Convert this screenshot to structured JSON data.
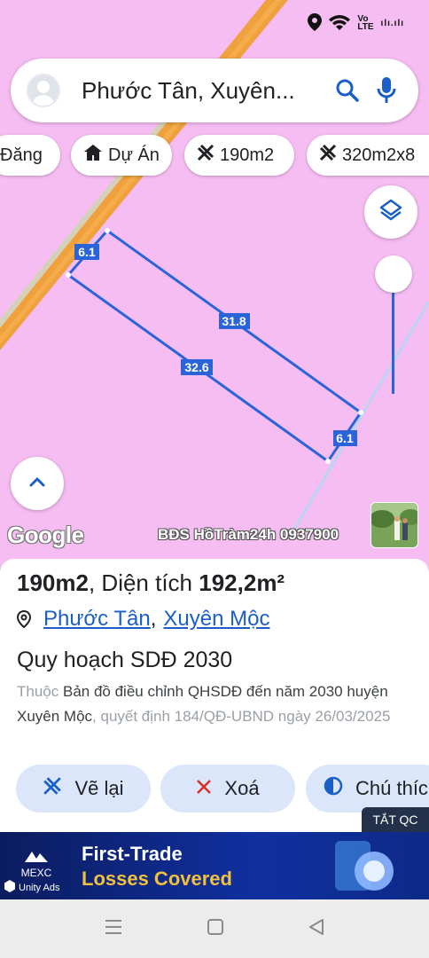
{
  "status_bar": {
    "volte_label": "Vo\nLTE",
    "signal_text": "ılı.ılı"
  },
  "search": {
    "text": "Phước Tân, Xuyên..."
  },
  "chips": [
    {
      "label": "Đăng",
      "icon": ""
    },
    {
      "label": "Dự Án",
      "icon": "house-icon"
    },
    {
      "label": "190m2",
      "icon": "measure-icon"
    },
    {
      "label": "320m2x8",
      "icon": "measure-icon"
    }
  ],
  "map": {
    "edge_labels": [
      "6.1",
      "31.8",
      "32.6",
      "6.1"
    ],
    "google_logo": "Google",
    "watermark": "BĐS HồTràm24h 0937900"
  },
  "info": {
    "title_prefix": "190m2",
    "title_mid": ", Diện tích ",
    "area_value": "192,2m²",
    "ward": "Phước Tân",
    "district": "Xuyên Mộc",
    "plan_title": "Quy hoạch SDĐ 2030",
    "desc_prefix": "Thuộc ",
    "desc_main": "Bản đồ điều chỉnh QHSDĐ đến năm 2030 huyện Xuyên Mộc",
    "desc_suffix": ", quyết định 184/QĐ-UBND ngày 26/03/2025"
  },
  "actions": {
    "redraw": "Vẽ lại",
    "delete": "Xoá",
    "notes": "Chú thíc"
  },
  "ad": {
    "hide_label": "TẮT QC",
    "brand": "MEXC",
    "line1": "First-Trade",
    "line2": "Losses Covered",
    "sdk": "Unity Ads"
  },
  "colors": {
    "map_bg": "#f6bdf3",
    "road": "#f0a03c",
    "parcel_line": "#2b63d9",
    "accent": "#1a5fc8"
  }
}
